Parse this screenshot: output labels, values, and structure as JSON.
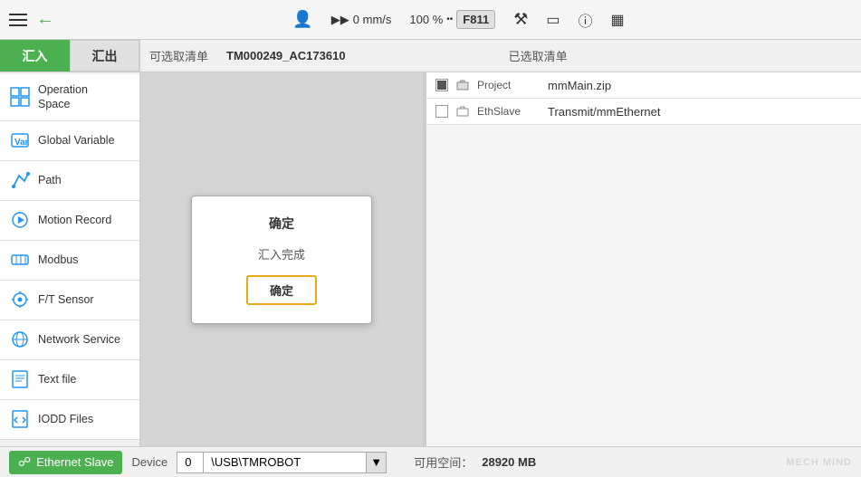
{
  "topbar": {
    "speed_label": "0 mm/s",
    "percent_label": "100 %",
    "f811_label": "F811",
    "icons": [
      "robot-icon",
      "network-icon",
      "info-icon",
      "screen-icon"
    ]
  },
  "sidebar": {
    "tab_import": "汇入",
    "tab_export": "汇出",
    "items": [
      {
        "id": "operation-space",
        "label": "Operation\nSpace",
        "icon": "grid-icon"
      },
      {
        "id": "global-variable",
        "label": "Global Variable",
        "icon": "var-icon"
      },
      {
        "id": "path",
        "label": "Path",
        "icon": "path-icon"
      },
      {
        "id": "motion-record",
        "label": "Motion Record",
        "icon": "motion-icon"
      },
      {
        "id": "modbus",
        "label": "Modbus",
        "icon": "modbus-icon"
      },
      {
        "id": "ft-sensor",
        "label": "F/T Sensor",
        "icon": "sensor-icon"
      },
      {
        "id": "network-service",
        "label": "Network Service",
        "icon": "network-icon"
      },
      {
        "id": "text-file",
        "label": "Text file",
        "icon": "text-icon"
      },
      {
        "id": "iodd-files",
        "label": "IODD Files",
        "icon": "iodd-icon"
      }
    ]
  },
  "content": {
    "selectable_list_label": "可选取清单",
    "record_id": "TM000249_AC173610",
    "selected_list_label": "已选取清单",
    "files": [
      {
        "category": "Project",
        "name": "mmMain.zip",
        "checked": false
      },
      {
        "category": "EthSlave",
        "name": "Transmit/mmEthernet",
        "checked": false
      }
    ]
  },
  "dialog": {
    "title": "确定",
    "message": "汇入完成",
    "confirm_button": "确定"
  },
  "bottombar": {
    "ethernet_slave_label": "Ethernet Slave",
    "device_label": "Device",
    "device_number": "0",
    "device_path": "\\USB\\TMROBOT",
    "space_label": "可用空间：",
    "space_value": "28920 MB",
    "logo": "MECH  MIND"
  }
}
